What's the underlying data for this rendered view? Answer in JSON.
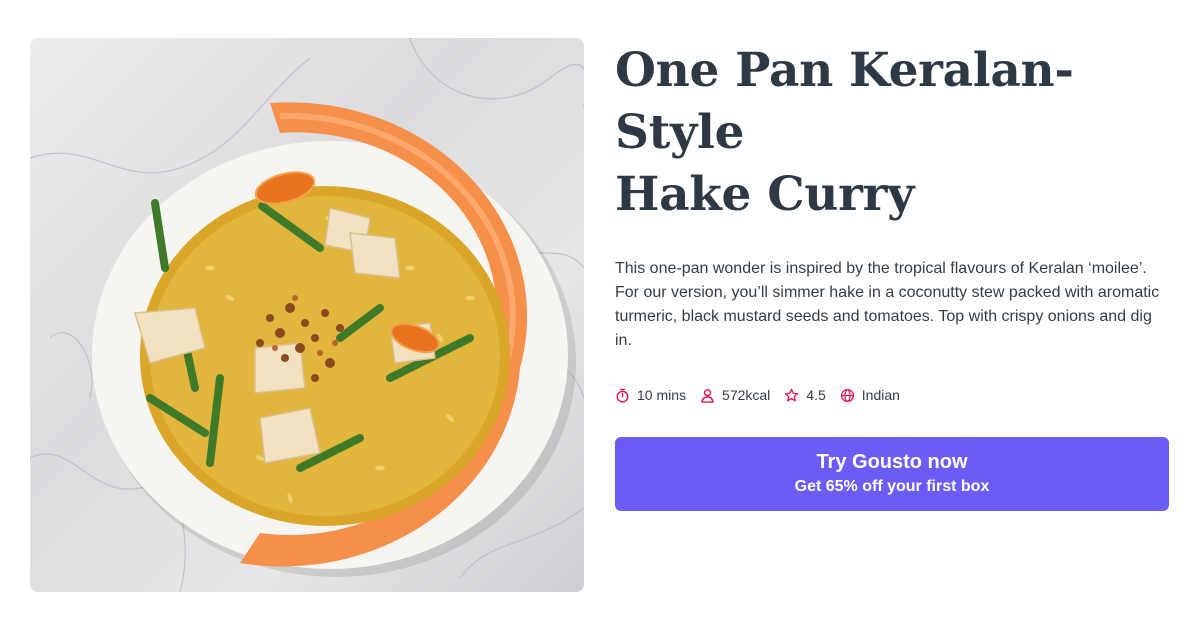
{
  "recipe": {
    "title_line1": "One Pan Keralan-Style",
    "title_line2": "Hake Curry",
    "description": "This one-pan wonder is inspired by the tropical flavours of Keralan ‘moilee’. For our version, you’ll simmer hake in a coconutty stew packed with aromatic turmeric, black mustard seeds and tomatoes. Top with crispy onions and dig in.",
    "image_alt": "One Pan Keralan-Style Hake Curry"
  },
  "meta": {
    "time": {
      "icon": "stopwatch-icon",
      "label": "10 mins"
    },
    "calories": {
      "icon": "person-icon",
      "label": "572kcal"
    },
    "rating": {
      "icon": "star-icon",
      "label": "4.5"
    },
    "cuisine": {
      "icon": "globe-icon",
      "label": "Indian"
    }
  },
  "cta": {
    "label": "Try Gousto now",
    "sublabel": "Get 65% off your first box"
  },
  "colors": {
    "title": "#2d3a45",
    "text": "#333d47",
    "icon_accent": "#e0184d",
    "cta_background": "#6b5cf6",
    "cta_text": "#ffffff"
  }
}
